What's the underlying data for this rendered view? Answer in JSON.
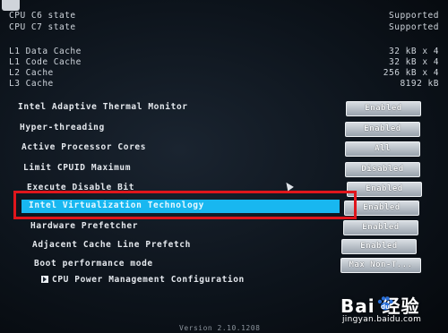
{
  "cpu_info": [
    {
      "label": "CPU C6 state",
      "value": "Supported"
    },
    {
      "label": "CPU C7 state",
      "value": "Supported"
    }
  ],
  "cache_info": [
    {
      "label": "L1 Data Cache",
      "value": "32 kB x 4"
    },
    {
      "label": "L1 Code Cache",
      "value": "32 kB x 4"
    },
    {
      "label": "L2 Cache",
      "value": "256 kB x 4"
    },
    {
      "label": "L3 Cache",
      "value": "8192 kB"
    }
  ],
  "settings": [
    {
      "label": "Intel Adaptive Thermal Monitor",
      "value": "Enabled"
    },
    {
      "label": "Hyper-threading",
      "value": "Enabled"
    },
    {
      "label": "Active Processor Cores",
      "value": "All"
    },
    {
      "label": "Limit CPUID Maximum",
      "value": "Disabled"
    },
    {
      "label": "Execute Disable Bit",
      "value": "Enabled"
    },
    {
      "label": "Intel Virtualization Technology",
      "value": "Enabled"
    },
    {
      "label": "Hardware Prefetcher",
      "value": "Enabled"
    },
    {
      "label": "Adjacent Cache Line Prefetch",
      "value": "Enabled"
    },
    {
      "label": "Boot performance mode",
      "value": "Max Non-T..."
    }
  ],
  "submenu": {
    "label": "CPU Power Management Configuration"
  },
  "footer": {
    "text": "Version 2.10.1208"
  },
  "watermark": {
    "brand": "Bai  经验",
    "url": "jingyan.baidu.com"
  },
  "colors": {
    "highlight": "#18b7f0",
    "annotation": "#e0161c",
    "background": "#0d141c"
  }
}
